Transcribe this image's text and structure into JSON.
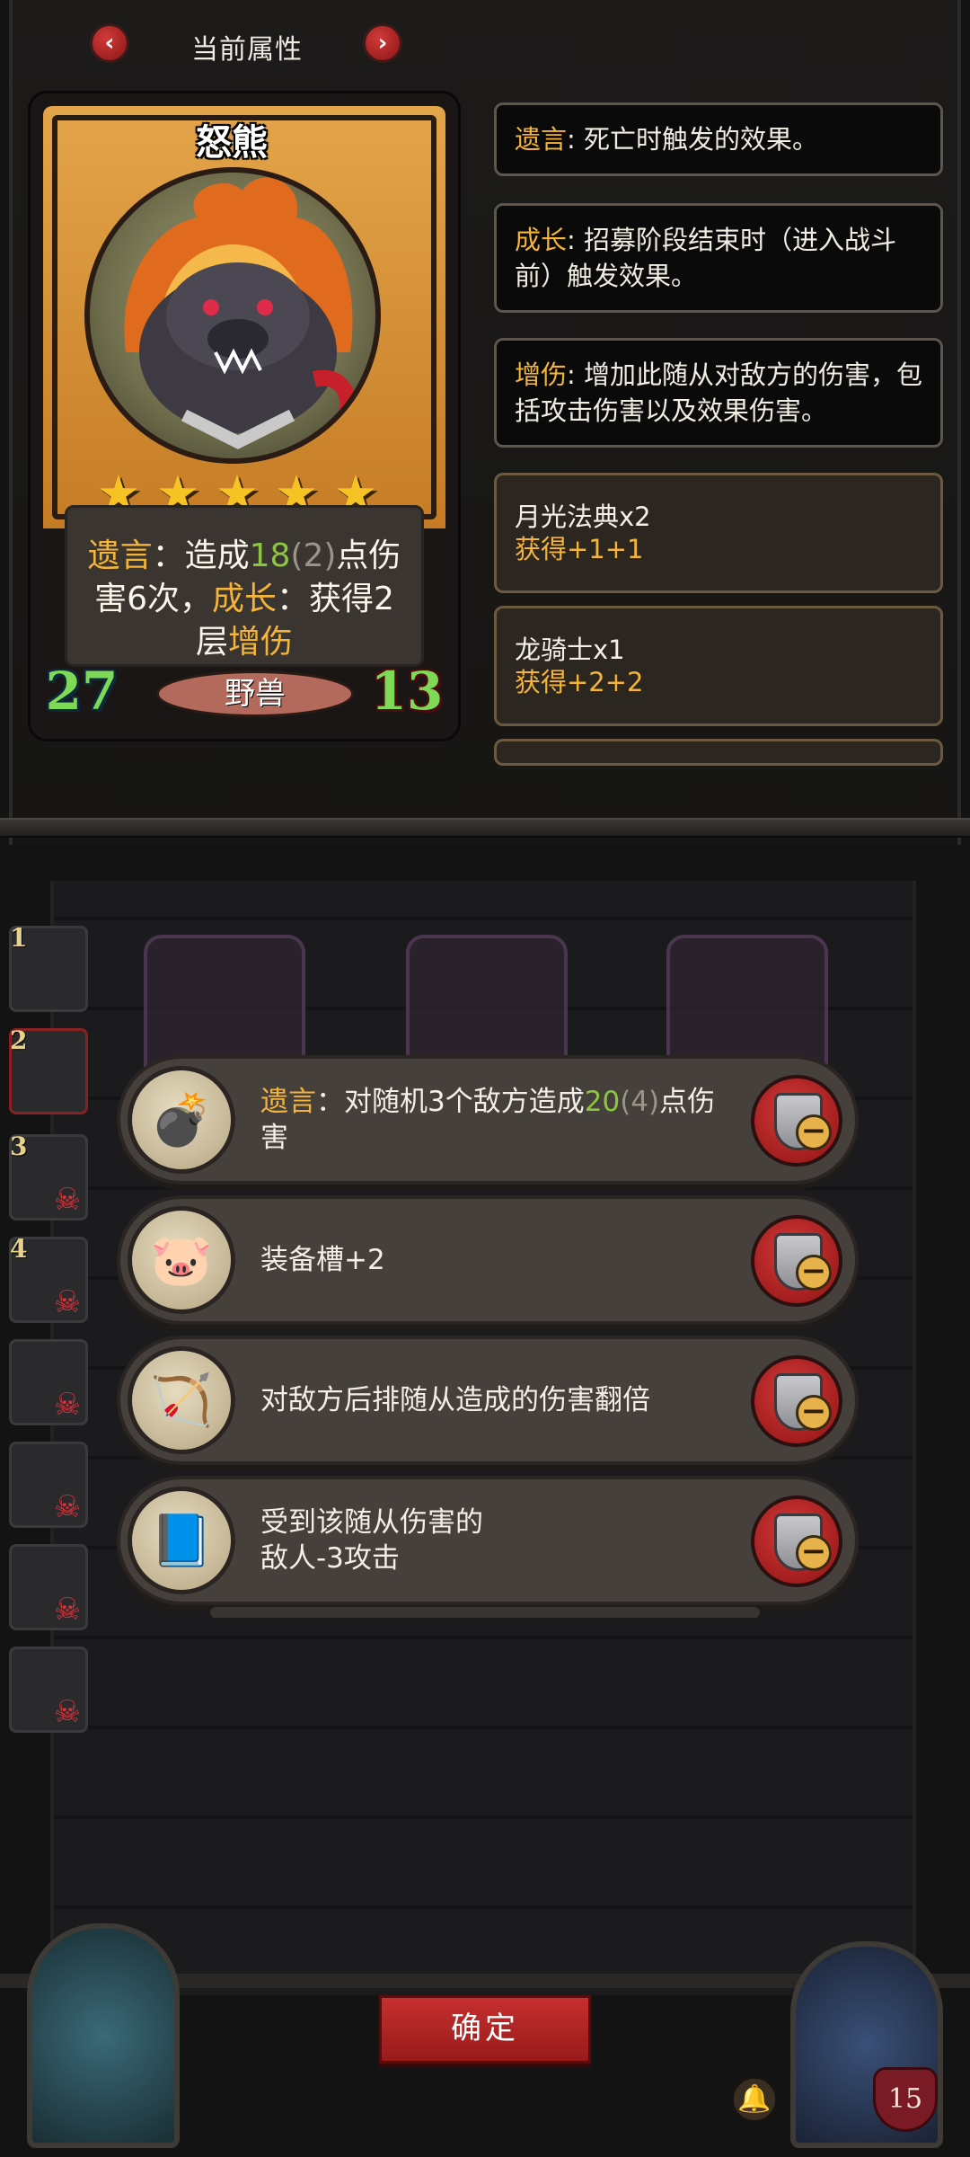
{
  "header": {
    "title": "当前属性",
    "prev_icon": "‹",
    "next_icon": "›"
  },
  "card": {
    "name": "怒熊",
    "stars": 5,
    "desc": {
      "deathrattle": "遗言",
      "sep1": "：造成",
      "damage": "18",
      "damage_paren": "(2)",
      "mid": "点伤害6次，",
      "growth": "成长",
      "sep2": "：获得2层",
      "buff": "增伤"
    },
    "attack": "27",
    "health": "13",
    "tribe": "野兽"
  },
  "keywords": [
    {
      "term": "遗言",
      "text": ": 死亡时触发的效果。"
    },
    {
      "term": "成长",
      "text": ": 招募阶段结束时（进入战斗前）触发效果。"
    },
    {
      "term": "增伤",
      "text": ": 增加此随从对敌方的伤害，包括攻击伤害以及效果伤害。"
    }
  ],
  "items": [
    {
      "name": "月光法典x2",
      "gain": "获得+1+1"
    },
    {
      "name": "龙骑士x1",
      "gain": "获得+2+2"
    }
  ],
  "sidebar": {
    "slots": [
      "1",
      "2",
      "3",
      "4",
      "",
      "",
      "",
      ""
    ]
  },
  "equipment": [
    {
      "icon": "bomb-icon",
      "term": "遗言",
      "text_a": "：对随机3个敌方造成",
      "num": "20",
      "num_paren": "(4)",
      "text_b": "点伤害"
    },
    {
      "icon": "pig-icon",
      "text": "装备槽+2"
    },
    {
      "icon": "crossbow-icon",
      "text": "对敌方后排随从造成的伤害翻倍"
    },
    {
      "icon": "spellbook-icon",
      "text": "受到该随从伤害的敌人-3攻击"
    }
  ],
  "footer": {
    "confirm": "确定",
    "hero_hp": "15"
  }
}
